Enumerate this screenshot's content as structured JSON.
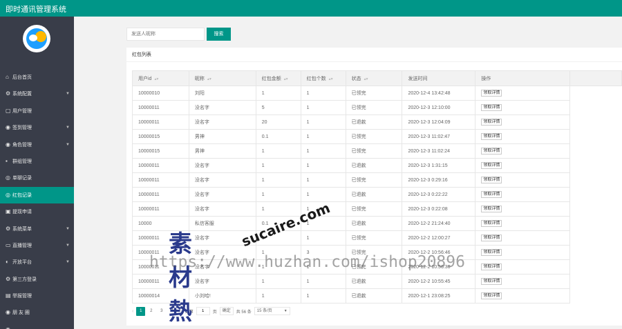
{
  "app": {
    "title": "即时通讯管理系统"
  },
  "sidebar": {
    "items": [
      {
        "icon": "home-icon",
        "glyph": "⌂",
        "label": "后台首页",
        "has_caret": false,
        "active": false
      },
      {
        "icon": "gear-icon",
        "glyph": "⚙",
        "label": "系统配置",
        "has_caret": true,
        "active": false
      },
      {
        "icon": "user-icon",
        "glyph": "▢",
        "label": "用户管理",
        "has_caret": false,
        "active": false
      },
      {
        "icon": "sign-in-icon",
        "glyph": "◉",
        "label": "签到管理",
        "has_caret": true,
        "active": false
      },
      {
        "icon": "role-icon",
        "glyph": "◉",
        "label": "角色管理",
        "has_caret": true,
        "active": false
      },
      {
        "icon": "group-icon",
        "glyph": "▪",
        "label": "群组管理",
        "has_caret": false,
        "active": false
      },
      {
        "icon": "chat-icon",
        "glyph": "◎",
        "label": "单聊记录",
        "has_caret": false,
        "active": false
      },
      {
        "icon": "red-packet-icon",
        "glyph": "◎",
        "label": "红包记录",
        "has_caret": false,
        "active": true
      },
      {
        "icon": "withdraw-icon",
        "glyph": "▣",
        "label": "提现申请",
        "has_caret": false,
        "active": false
      },
      {
        "icon": "menu-icon",
        "glyph": "⚙",
        "label": "系统菜单",
        "has_caret": true,
        "active": false
      },
      {
        "icon": "live-icon",
        "glyph": "▭",
        "label": "直播管理",
        "has_caret": true,
        "active": false
      },
      {
        "icon": "platform-icon",
        "glyph": "◐",
        "label": "开放平台",
        "has_caret": true,
        "active": false
      },
      {
        "icon": "third-login-icon",
        "glyph": "⚙",
        "label": "第三方登录",
        "has_caret": false,
        "active": false
      },
      {
        "icon": "report-icon",
        "glyph": "▤",
        "label": "举报管理",
        "has_caret": false,
        "active": false
      },
      {
        "icon": "moments-icon",
        "glyph": "◉",
        "label": "朋 友 圈",
        "has_caret": false,
        "active": false
      },
      {
        "icon": "misc-icon",
        "glyph": "◉",
        "label": "…",
        "has_caret": false,
        "active": false
      }
    ]
  },
  "search": {
    "placeholder": "发送人昵称",
    "button_label": "搜索"
  },
  "panel": {
    "title": "红包列表"
  },
  "table": {
    "columns": [
      "用户id",
      "昵称",
      "红包金额",
      "红包个数",
      "状态",
      "发送时间",
      "操作"
    ],
    "sortable": [
      true,
      true,
      true,
      true,
      true,
      false,
      false
    ],
    "action_label": "领取详情",
    "rows": [
      [
        "10000010",
        "刘阳",
        "1",
        "1",
        "已领完",
        "2020-12-4 13:42:48"
      ],
      [
        "10000011",
        "没名字",
        "5",
        "1",
        "已领完",
        "2020-12-3 12:10:00"
      ],
      [
        "10000011",
        "没名字",
        "20",
        "1",
        "已退款",
        "2020-12-3 12:04:09"
      ],
      [
        "10000015",
        "男神",
        "0.1",
        "1",
        "已领完",
        "2020-12-3 11:02:47"
      ],
      [
        "10000015",
        "男神",
        "1",
        "1",
        "已领完",
        "2020-12-3 11:02:24"
      ],
      [
        "10000011",
        "没名字",
        "1",
        "1",
        "已退款",
        "2020-12-3 1:31:15"
      ],
      [
        "10000011",
        "没名字",
        "1",
        "1",
        "已领完",
        "2020-12-3 0:29:16"
      ],
      [
        "10000011",
        "没名字",
        "1",
        "1",
        "已退款",
        "2020-12-3 0:22:22"
      ],
      [
        "10000011",
        "没名字",
        "1",
        "1",
        "已领完",
        "2020-12-3 0:22:08"
      ],
      [
        "10000",
        "私信客服",
        "0.1",
        "1",
        "已退款",
        "2020-12-2 21:24:40"
      ],
      [
        "10000011",
        "没名字",
        "1",
        "1",
        "已领完",
        "2020-12-2 12:00:27"
      ],
      [
        "10000011",
        "没名字",
        "1",
        "3",
        "已领完",
        "2020-12-2 10:56:46"
      ],
      [
        "10000011",
        "没名字",
        "1",
        "1",
        "已领完",
        "2020-12-2 10:56:30"
      ],
      [
        "10000011",
        "没名字",
        "1",
        "1",
        "已退款",
        "2020-12-2 10:55:45"
      ],
      [
        "10000014",
        "小刘哈!",
        "1",
        "1",
        "已退款",
        "2020-12-1 23:08:25"
      ]
    ]
  },
  "pagination": {
    "pages": [
      "1",
      "2",
      "3",
      "4"
    ],
    "current": "1",
    "goto_prefix": "到第",
    "goto_value": "1",
    "goto_suffix": "页",
    "confirm_label": "确定",
    "total_text": "共 56 条",
    "page_size": "15 条/页"
  },
  "watermark": {
    "logo_text": "素材熱",
    "domain_text": "sucaire.com",
    "url_text": "https://www.huzhan.com/ishop20896"
  }
}
